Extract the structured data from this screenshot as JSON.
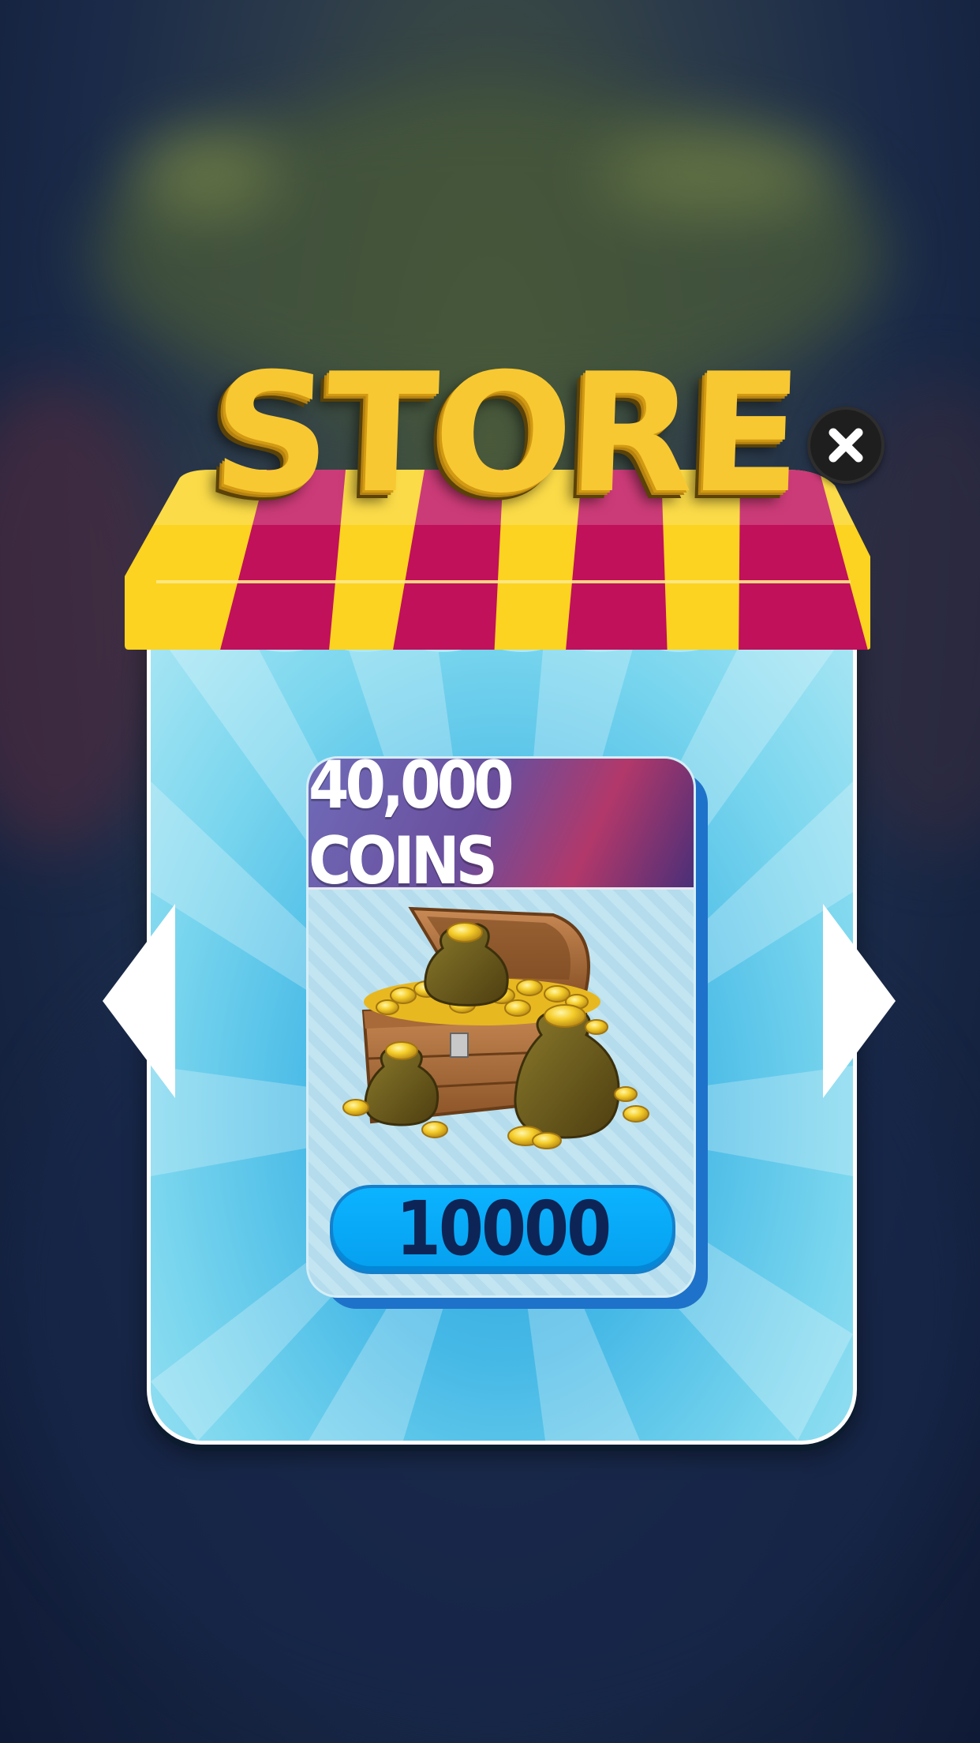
{
  "store": {
    "title": "STORE",
    "close_icon": "close-icon",
    "prev_icon": "arrow-left-icon",
    "next_icon": "arrow-right-icon"
  },
  "offer": {
    "title": "40,000 COINS",
    "image": "treasure-chest-with-coin-bags",
    "price": "10000"
  },
  "colors": {
    "title_gold": "#f8c833",
    "awning_yellow": "#fbd320",
    "awning_magenta": "#c0115a",
    "panel_blue": "#45b8e6",
    "button_blue": "#0bb3ff",
    "price_text": "#0d2556"
  }
}
